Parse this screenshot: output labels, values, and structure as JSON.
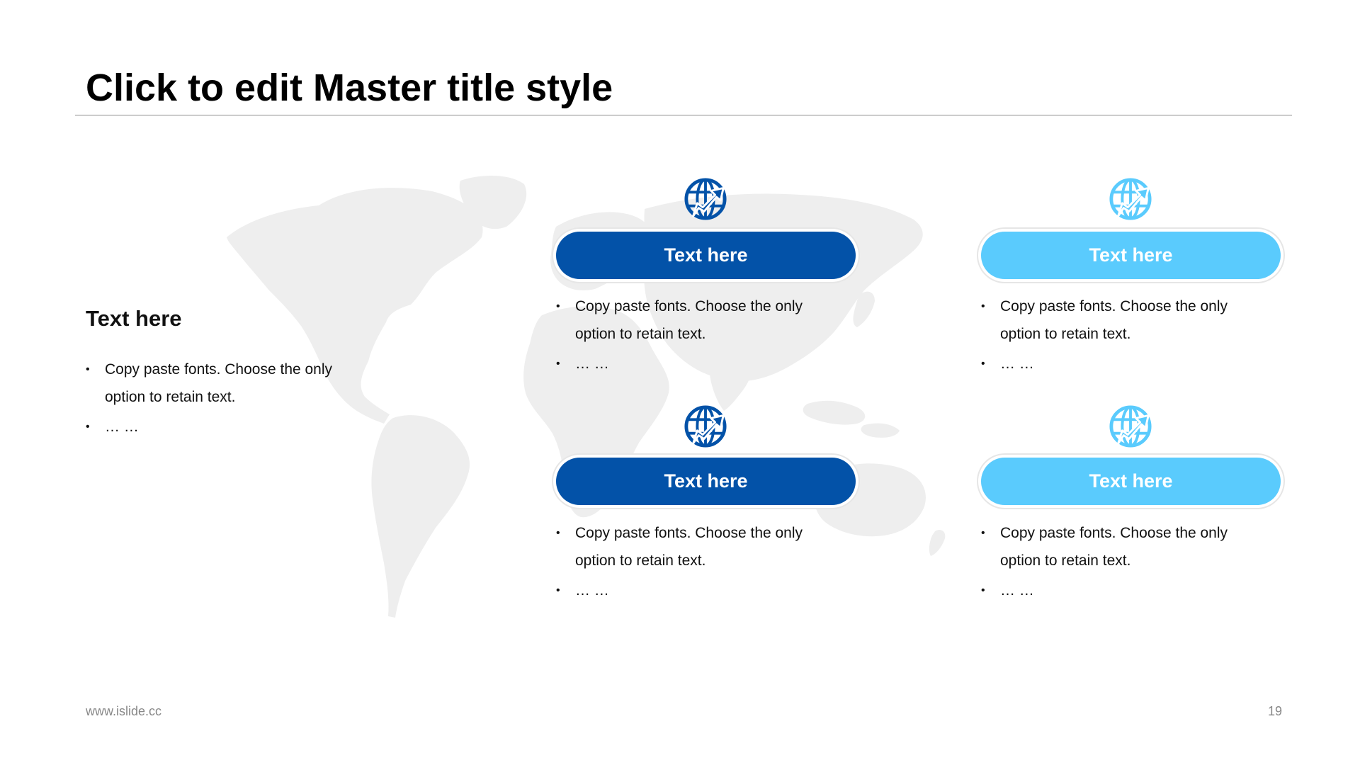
{
  "slide": {
    "title": "Click to edit Master title style"
  },
  "intro": {
    "heading": "Text here",
    "bullets": [
      "Copy paste fonts. Choose the only\noption to retain text.",
      "… …"
    ]
  },
  "cards": [
    {
      "label": "Text here",
      "icon": "globe-arrow-icon",
      "bullets": [
        "Copy paste fonts. Choose the only\noption to retain text.",
        "… …"
      ]
    },
    {
      "label": "Text here",
      "icon": "globe-arrow-icon",
      "bullets": [
        "Copy paste fonts. Choose the only\noption to retain text.",
        "… …"
      ]
    },
    {
      "label": "Text here",
      "icon": "globe-arrow-icon",
      "bullets": [
        "Copy paste fonts. Choose the only\noption to retain text.",
        "… …"
      ]
    },
    {
      "label": "Text here",
      "icon": "globe-arrow-icon",
      "bullets": [
        "Copy paste fonts. Choose the only\noption to retain text.",
        "… …"
      ]
    }
  ],
  "colors": {
    "accent_dark": "#0352a8",
    "accent_light": "#5acbfd",
    "map_fill": "#eeeeee",
    "rule": "#8a8a8a"
  },
  "footer": {
    "url": "www.islide.cc",
    "page_number": "19"
  }
}
